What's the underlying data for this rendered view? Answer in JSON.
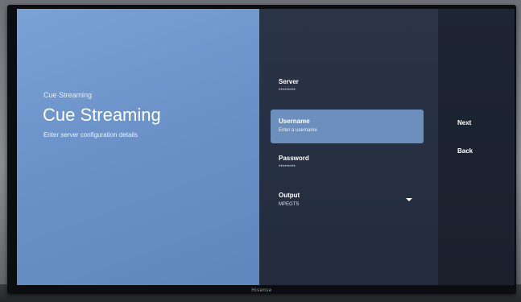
{
  "left": {
    "overline": "Cue Streaming",
    "title": "Cue Streaming",
    "description": "Enter server configuration details"
  },
  "fields": [
    {
      "label": "Server",
      "value": "*********"
    },
    {
      "label": "Username",
      "value": "Enter a username"
    },
    {
      "label": "Password",
      "value": "*********"
    },
    {
      "label": "Output",
      "value": "MPEGTS"
    }
  ],
  "actions": {
    "next": "Next",
    "back": "Back"
  },
  "tv_brand": "Hisense",
  "icons": {
    "output_dropdown": "chevron-down-icon"
  },
  "colors": {
    "left_pane": "#6b93c9",
    "center_pane": "#283144",
    "focus": "#6c8fbd",
    "right_pane": "#1c2230"
  }
}
